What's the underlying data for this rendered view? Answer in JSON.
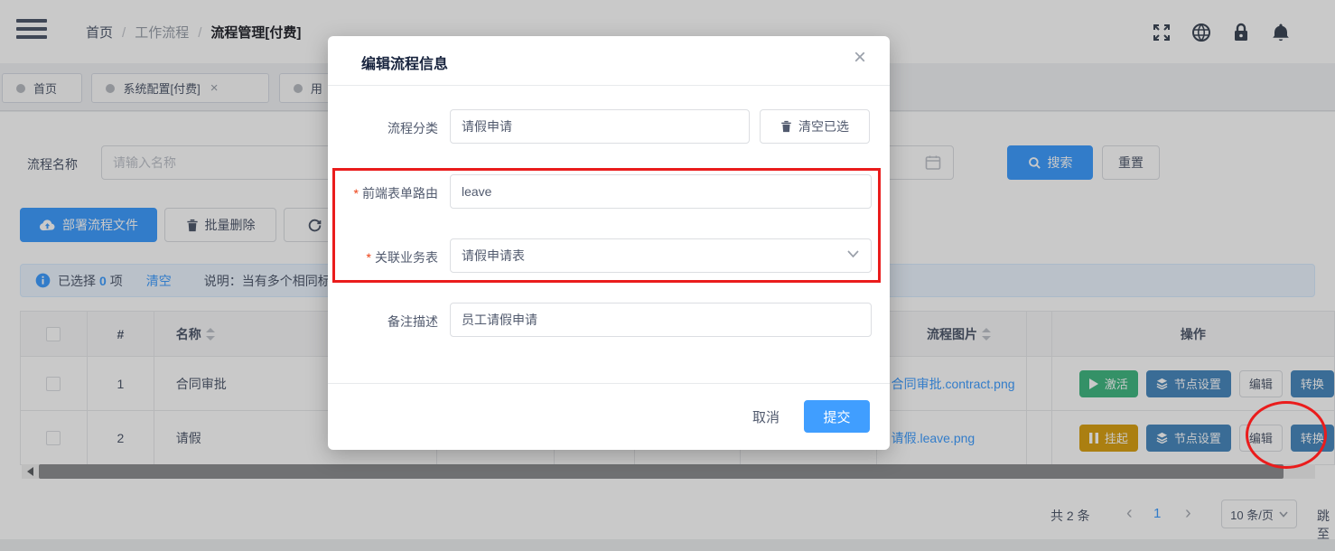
{
  "colors": {
    "primary": "#409eff",
    "green": "#42b983",
    "amber": "#d9a116",
    "steel_blue": "#4a8abf",
    "annotation_red": "#ea1c1c",
    "link": "#409eff"
  },
  "breadcrumb": {
    "home": "首页",
    "sep1": "/",
    "mid": "工作流程",
    "sep2": "/",
    "current": "流程管理[付费]"
  },
  "tabs": [
    {
      "label": "首页"
    },
    {
      "label": "系统配置[付费]",
      "close": "×"
    },
    {
      "label": "用"
    }
  ],
  "search": {
    "name_label": "流程名称",
    "name_placeholder": "请输入名称",
    "search_label": "搜索",
    "reset_label": "重置"
  },
  "toolbar": {
    "deploy_label": "部署流程文件",
    "batch_delete_label": "批量删除",
    "refresh_label": "刷新"
  },
  "alert": {
    "selected_prefix": "已选择",
    "selected_count": "0",
    "selected_suffix": "项",
    "clear_label": "清空",
    "note": "说明：当有多个相同标"
  },
  "table": {
    "headers": {
      "index": "#",
      "name": "名称",
      "image": "流程图片",
      "actions": "操作"
    },
    "rows": [
      {
        "index": "1",
        "name": "合同审批",
        "image": "合同审批.contract.png",
        "state_label": "激活",
        "node_label": "节点设置",
        "edit_label": "编辑",
        "convert_label": "转换"
      },
      {
        "index": "2",
        "name": "请假",
        "image": "请假.leave.png",
        "state_label": "挂起",
        "node_label": "节点设置",
        "edit_label": "编辑",
        "convert_label": "转换"
      }
    ]
  },
  "pagination": {
    "total": "共 2 条",
    "prev": "‹",
    "page": "1",
    "next": "›",
    "page_size": "10 条/页",
    "jump_label": "跳至"
  },
  "modal": {
    "title": "编辑流程信息",
    "close": "×",
    "required_mark": "*",
    "category_label": "流程分类",
    "category_value": "请假申请",
    "clear_selected_label": "清空已选",
    "route_label": "前端表单路由",
    "route_value": "leave",
    "biz_label": "关联业务表",
    "biz_value": "请假申请表",
    "remark_label": "备注描述",
    "remark_value": "员工请假申请",
    "cancel_label": "取消",
    "submit_label": "提交"
  }
}
